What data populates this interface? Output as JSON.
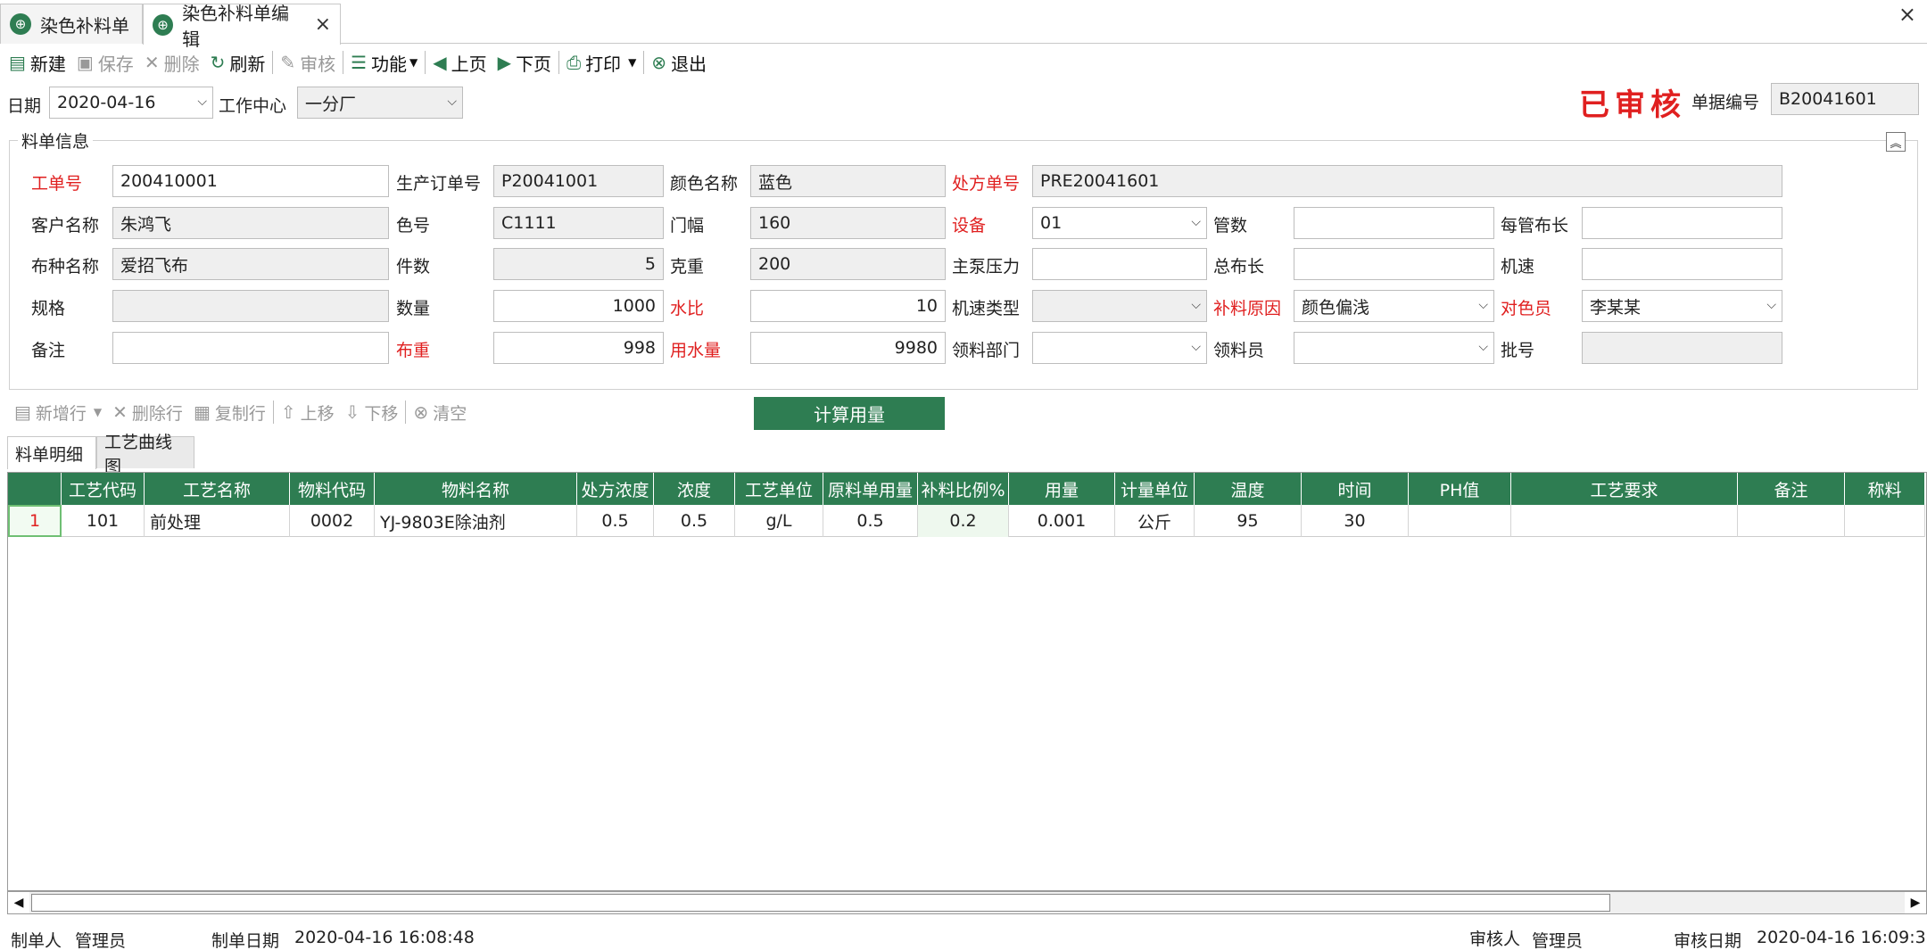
{
  "tabs": [
    {
      "label": "染色补料单"
    },
    {
      "label": "染色补料单编辑"
    }
  ],
  "toolbar": {
    "new": "新建",
    "save": "保存",
    "delete": "删除",
    "refresh": "刷新",
    "audit": "审核",
    "function": "功能",
    "prev": "上页",
    "next": "下页",
    "print": "打印",
    "exit": "退出"
  },
  "header": {
    "date_label": "日期",
    "date_value": "2020-04-16",
    "workcenter_label": "工作中心",
    "workcenter_value": "一分厂",
    "status_stamp": "已审核",
    "docno_label": "单据编号",
    "docno_value": "B20041601"
  },
  "section": {
    "title": "料单信息"
  },
  "form": {
    "work_no": {
      "label": "工单号",
      "value": "200410001"
    },
    "prod_order": {
      "label": "生产订单号",
      "value": "P20041001"
    },
    "color_name": {
      "label": "颜色名称",
      "value": "蓝色"
    },
    "recipe_no": {
      "label": "处方单号",
      "value": "PRE20041601"
    },
    "customer": {
      "label": "客户名称",
      "value": "朱鸿飞"
    },
    "color_no": {
      "label": "色号",
      "value": "C1111"
    },
    "width": {
      "label": "门幅",
      "value": "160"
    },
    "equipment": {
      "label": "设备",
      "value": "01"
    },
    "tubes": {
      "label": "管数",
      "value": ""
    },
    "tube_len": {
      "label": "每管布长",
      "value": ""
    },
    "fabric": {
      "label": "布种名称",
      "value": "爱招飞布"
    },
    "pieces": {
      "label": "件数",
      "value": "5"
    },
    "gram": {
      "label": "克重",
      "value": "200"
    },
    "pump": {
      "label": "主泵压力",
      "value": ""
    },
    "total_len": {
      "label": "总布长",
      "value": ""
    },
    "speed": {
      "label": "机速",
      "value": ""
    },
    "spec": {
      "label": "规格",
      "value": ""
    },
    "qty": {
      "label": "数量",
      "value": "1000"
    },
    "water_ratio": {
      "label": "水比",
      "value": "10"
    },
    "speed_type": {
      "label": "机速类型",
      "value": ""
    },
    "reason": {
      "label": "补料原因",
      "value": "颜色偏浅"
    },
    "matcher": {
      "label": "对色员",
      "value": "李某某"
    },
    "remark": {
      "label": "备注",
      "value": ""
    },
    "cloth_weight": {
      "label": "布重",
      "value": "998"
    },
    "water_use": {
      "label": "用水量",
      "value": "9980"
    },
    "dept": {
      "label": "领料部门",
      "value": ""
    },
    "picker": {
      "label": "领料员",
      "value": ""
    },
    "batch": {
      "label": "批号",
      "value": ""
    }
  },
  "subtoolbar": {
    "add_row": "新增行",
    "del_row": "删除行",
    "copy_row": "复制行",
    "up": "上移",
    "down": "下移",
    "clear": "清空",
    "calc": "计算用量"
  },
  "detail_tabs": [
    "料单明细",
    "工艺曲线图"
  ],
  "grid": {
    "columns": [
      "",
      "工艺代码",
      "工艺名称",
      "物料代码",
      "物料名称",
      "处方浓度",
      "浓度",
      "工艺单位",
      "原料单用量",
      "补料比例%",
      "用量",
      "计量单位",
      "温度",
      "时间",
      "PH值",
      "工艺要求",
      "备注",
      "称料"
    ],
    "rows": [
      [
        "1",
        "101",
        "前处理",
        "0002",
        "YJ-9803E除油剂",
        "0.5",
        "0.5",
        "g/L",
        "0.5",
        "0.2",
        "0.001",
        "公斤",
        "95",
        "30",
        "",
        "",
        "",
        ""
      ]
    ]
  },
  "footer": {
    "maker_label": "制单人",
    "maker_value": "管理员",
    "make_date_label": "制单日期",
    "make_date_value": "2020-04-16 16:08:48",
    "auditor_label": "审核人",
    "auditor_value": "管理员",
    "audit_date_label": "审核日期",
    "audit_date_value": "2020-04-16 16:09:3"
  },
  "colors": {
    "accent": "#2e7d52",
    "required": "#e02020",
    "stamp": "#e02020"
  },
  "icons": [
    "globe-icon",
    "close-icon",
    "new-doc-icon",
    "save-icon",
    "delete-icon",
    "refresh-icon",
    "audit-icon",
    "list-icon",
    "prev-arrow-icon",
    "next-arrow-icon",
    "print-icon",
    "exit-icon",
    "chevron-down-icon",
    "collapse-icon"
  ]
}
